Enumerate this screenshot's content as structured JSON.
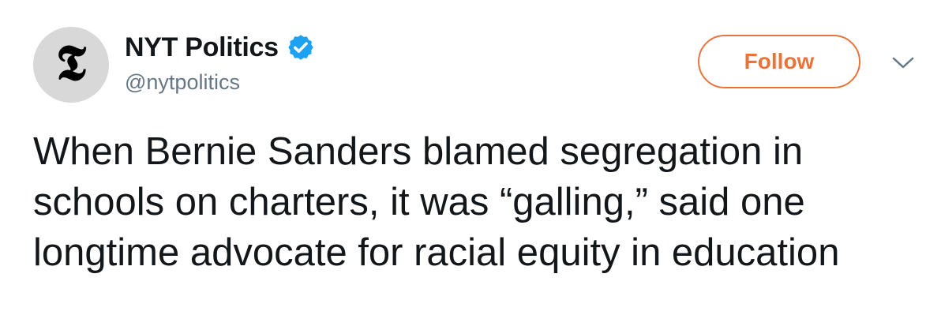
{
  "account": {
    "display_name": "NYT Politics",
    "handle": "@nytpolitics",
    "avatar_glyph": "𝕿",
    "verified": true
  },
  "actions": {
    "follow_label": "Follow",
    "more_icon": "chevron-down-icon"
  },
  "tweet": {
    "text": "When Bernie Sanders blamed segregation in schools on charters, it was “galling,” said one longtime advocate for racial equity in education"
  },
  "colors": {
    "follow_accent": "#e8743b",
    "verified_blue": "#1da1f2",
    "handle_gray": "#657786",
    "text": "#14171a",
    "avatar_bg": "#d8d8d8"
  }
}
